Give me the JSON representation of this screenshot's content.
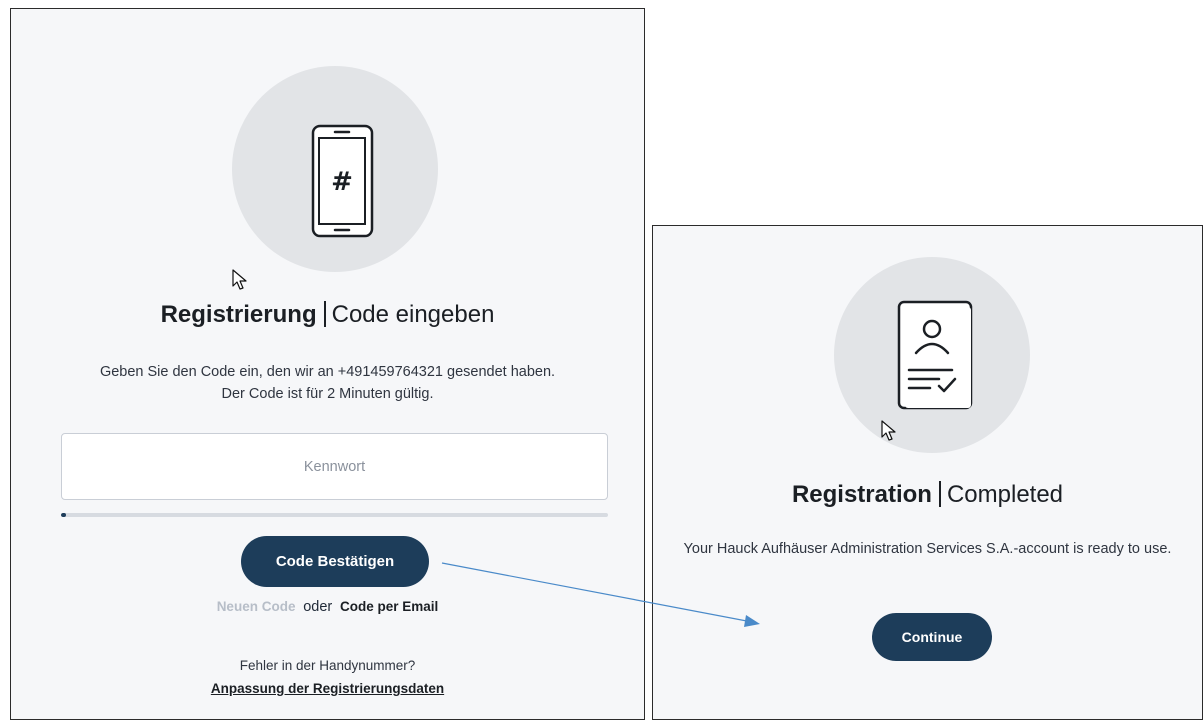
{
  "registration": {
    "title_strong": "Registrierung",
    "title_light": "Code eingeben",
    "description_line1": "Geben Sie den Code ein, den wir an +491459764321 gesendet haben.",
    "description_line2": "Der Code ist für 2 Minuten gültig.",
    "code_input": {
      "placeholder": "Kennwort",
      "value": ""
    },
    "timer_progress_fraction": 0.01,
    "confirm_label": "Code Bestätigen",
    "new_code_label": "Neuen Code",
    "or_label": "oder",
    "email_code_label": "Code per Email",
    "phone_error_text": "Fehler in der Handynummer?",
    "adjust_link_label": "Anpassung der Registrierungsdaten",
    "icon": "phone-hash-icon"
  },
  "completed": {
    "title_strong": "Registration",
    "title_light": "Completed",
    "description": "Your Hauck Aufhäuser Administration Services S.A.-account is ready to use.",
    "continue_label": "Continue",
    "icon": "id-card-check-icon"
  },
  "colors": {
    "primary_button": "#1d3d5a",
    "panel_background": "#f6f7f9",
    "icon_circle": "#e2e4e7",
    "muted_link": "#b7bec8",
    "arrow": "#4a8ac9"
  }
}
